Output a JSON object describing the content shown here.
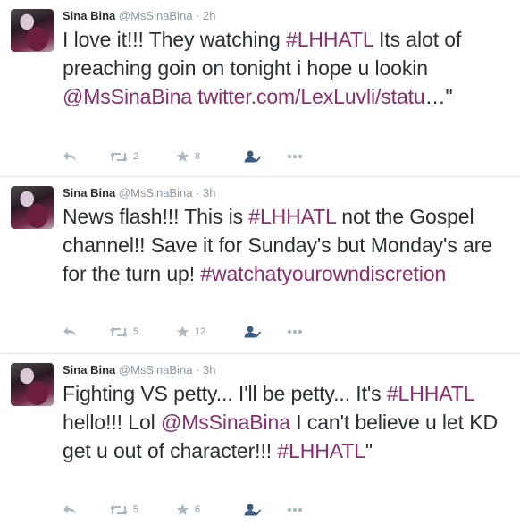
{
  "tweets": [
    {
      "name": "Sina Bina",
      "handle": "@MsSinaBina",
      "dot": "·",
      "time": "2h",
      "line1_a": "I love it!!! They watching ",
      "line1_tag": "#LHHATL",
      "line1_b": " Its alot of preaching goin on tonight i hope u lookin ",
      "mention": "@MsSinaBina",
      "link": "twitter.com/LexLuvli/statu",
      "tail": "…\"",
      "retweets": "2",
      "favorites": "8"
    },
    {
      "name": "Sina Bina",
      "handle": "@MsSinaBina",
      "dot": "·",
      "time": "3h",
      "part_a": "News flash!!! This is ",
      "tag1": "#LHHATL",
      "part_b": " not the Gospel channel!! Save it for Sunday's but Monday's are for the turn up! ",
      "tag2": "#watchatyourowndiscretion",
      "retweets": "5",
      "favorites": "12"
    },
    {
      "name": "Sina Bina",
      "handle": "@MsSinaBina",
      "dot": "·",
      "time": "3h",
      "part_a": "Fighting VS petty... I'll be petty... It's ",
      "tag1": "#LHHATL",
      "part_b": " hello!!! Lol ",
      "mention": "@MsSinaBina",
      "part_c": " I can't believe u let KD get u out of character!!! ",
      "tag2": "#LHHATL",
      "tail": "\"",
      "retweets": "5",
      "favorites": "6"
    }
  ],
  "icons": {
    "reply": "reply-icon",
    "retweet": "retweet-icon",
    "favorite": "star-icon",
    "follow": "follow-user-icon",
    "more": "more-dots-icon"
  },
  "colors": {
    "accent": "#8b2d6e",
    "muted": "#8899a6",
    "text": "#292f33"
  }
}
